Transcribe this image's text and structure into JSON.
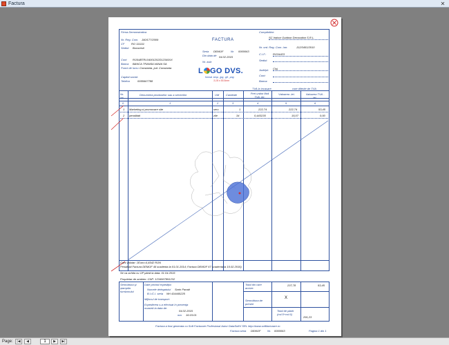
{
  "window": {
    "title": "Factura"
  },
  "status": {
    "page_label": "Page:",
    "page_value": "1"
  },
  "supplier": {
    "name": "Firma Demonstrativa",
    "reg_com_label": "Nr. Reg. Com.",
    "reg_com": "J40/177/2009",
    "cif_label": "CF",
    "cif": "RO 111111",
    "sediu_label": "Sediul:",
    "sediu": "Bucuresti",
    "cont_label": "Cont",
    "cont": "RO54BTRL04001202D12345XX",
    "banca_label": "Banca",
    "banca": "BANCA TRANSILVANIA SA",
    "punct_label": "Punct de lucru",
    "punct": "Constanta, jud. Constanta",
    "capital_label": "Capital social:",
    "telefon_label": "Telefon",
    "telefon": "0055667788"
  },
  "invoice": {
    "title": "FACTURA",
    "seria_label": "Seria",
    "seria": "DEMOF",
    "nr_label": "Nr",
    "nr": "0000063",
    "date_label": "Din data de",
    "date": "04.02.2015",
    "aviz_label": "Nr. aviz"
  },
  "logo": {
    "text_pre": "L",
    "text_post": "GO DVS.",
    "formats": "format .bmp, .jpg, .gif, .png",
    "size": "3.18 x 55.5mm"
  },
  "client": {
    "header": "Cumpărător:",
    "name": "SC Indoor Outdoor Decoration S.R.L.",
    "reg_label": "Nr. ord. Reg. Com. /an:",
    "reg": "J12/3451/2010",
    "cif_label": "C.I.F.:",
    "cif": "RO34423",
    "sediu_label": "Sediul:",
    "judet_label": "Judeţul:",
    "judet": "Cluj",
    "cont_label": "Cont:",
    "banca_label": "Banca:"
  },
  "vat": {
    "label": "TVA la incasare",
    "rate_label": "cote diferite de TVA"
  },
  "table": {
    "headers": {
      "nr": "Nr. crt.",
      "name": "Denumirea produselor sau a serviciilor",
      "um": "UM",
      "qty": "Cantitate",
      "price": "Pret unitar fără TVA -lei-",
      "value": "Valoarea -lei-",
      "vat": "Valoarea TVA -lei-"
    },
    "indices": {
      "nr": "0",
      "name": "1",
      "um": "2",
      "qty": "3",
      "price": "4",
      "value": "5",
      "vat": "6"
    },
    "rows": [
      {
        "nr": "1",
        "name": "Marketing si promovare site",
        "um": "serv",
        "qty": "1",
        "price": "222,74",
        "value": "222,74",
        "vat": "53,45"
      },
      {
        "nr": "2",
        "name": "penalitati",
        "um": "zile",
        "qty": "34",
        "price": "0,443235",
        "value": "15,07",
        "vat": "0,00"
      }
    ]
  },
  "notes": {
    "exchange": "Curs valutar: 1Euro=4,4542 RON",
    "penalty": "Penalitati Factura DEMOF 46 scadenta la 01.01.2014; Factura DEMOF 67 scadenta la 15.02.2015)",
    "payment": "Se va achita cu OP până la data: 01.04.2015",
    "agent": "Proprietar de ambien: CNP: 1234567891232"
  },
  "footer": {
    "sign_label": "Semnătura şi ştampila furnizorului",
    "expedition_label": "Date privind expediţia:",
    "delegate_label": "Numele delegatului",
    "delegate": "Sorin Panait",
    "bi_label": "B.I./C.I. seria",
    "bi": "NH 434445225",
    "transport_label": "Mijlocul de transport:",
    "expedition_text": "Expedierea s-a efectuat în prezenţa noastră la data de:",
    "exp_date": "04.02.2015",
    "ora_label": "ora",
    "ora": "16:15:01",
    "total_label": "Total din care accize:",
    "total_value": "237,78",
    "total_vat": "53,45",
    "receipt_label": "Semnătura de primire",
    "x_mark": "X",
    "pay_label": "Total de plată (col.5+col.6)",
    "pay_value": "291,23"
  },
  "generated": "Factura a fost generata cu Soft Facturare Profesional Autor DataSoftV SRL http://www.softfacturare.ro",
  "footer_series": {
    "label": "Factura seria",
    "seria": "DEMOF",
    "nr_label": "Nr.",
    "nr": "0000063",
    "page": "Pagina 1 din 1"
  },
  "colors": {
    "ink": "#1a3f8c",
    "arrow": "#d32f2f",
    "map": "#4a6fd6"
  }
}
